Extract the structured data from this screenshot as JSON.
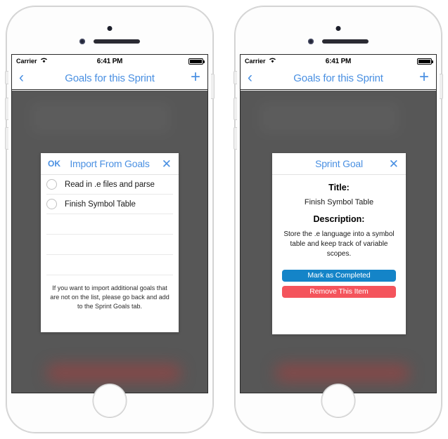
{
  "phones": [
    {
      "id": "left",
      "status_bar": {
        "carrier": "Carrier",
        "wifi_icon": "wifi-icon",
        "time": "6:41 PM",
        "battery_icon": "battery-full-icon"
      },
      "nav_bar": {
        "back_icon": "chevron-left-icon",
        "title": "Goals for this Sprint",
        "add_icon": "plus-icon"
      },
      "modal": {
        "kind": "import",
        "ok_label": "OK",
        "title": "Import From Goals",
        "close_icon": "close-x-icon",
        "goals": [
          {
            "label": "Read in .e files and parse",
            "selected": false
          },
          {
            "label": "Finish Symbol Table",
            "selected": false
          }
        ],
        "empty_rows": 3,
        "footer": "If you want to import additional goals that are not on the list, please go back and add to the Sprint Goals tab."
      }
    },
    {
      "id": "right",
      "status_bar": {
        "carrier": "Carrier",
        "wifi_icon": "wifi-icon",
        "time": "6:41 PM",
        "battery_icon": "battery-full-icon"
      },
      "nav_bar": {
        "back_icon": "chevron-left-icon",
        "title": "Goals for this Sprint",
        "add_icon": "plus-icon"
      },
      "modal": {
        "kind": "detail",
        "title": "Sprint Goal",
        "close_icon": "close-x-icon",
        "title_heading": "Title:",
        "title_value": "Finish Symbol Table",
        "description_heading": "Description:",
        "description_value": "Store the .e language into a symbol table and keep track of variable scopes.",
        "primary_button": "Mark as Completed",
        "danger_button": "Remove This Item"
      }
    }
  ],
  "colors": {
    "accent_blue": "#4a90e2",
    "button_blue": "#1484c8",
    "button_red": "#f4545c",
    "overlay": "#575757"
  }
}
